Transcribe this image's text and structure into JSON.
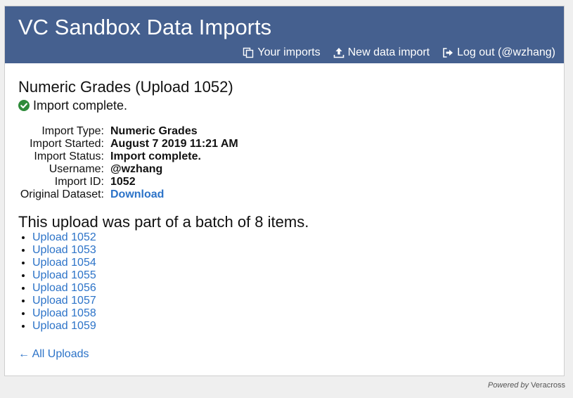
{
  "header": {
    "title": "VC Sandbox Data Imports",
    "nav": [
      {
        "label": "Your imports",
        "icon": "copy-icon"
      },
      {
        "label": "New data import",
        "icon": "upload-icon"
      },
      {
        "label": "Log out (@wzhang)",
        "icon": "logout-icon"
      }
    ]
  },
  "main": {
    "title": "Numeric Grades (Upload 1052)",
    "status": "Import complete.",
    "details": [
      {
        "label": "Import Type:",
        "value": "Numeric Grades"
      },
      {
        "label": "Import Started:",
        "value": "August 7 2019 11:21 AM"
      },
      {
        "label": "Import Status:",
        "value": "Import complete."
      },
      {
        "label": "Username:",
        "value": "@wzhang"
      },
      {
        "label": "Import ID:",
        "value": "1052"
      },
      {
        "label": "Original Dataset:",
        "value": "Download"
      }
    ],
    "batch_heading": "This upload was part of a batch of 8 items.",
    "batch_items": [
      "Upload 1052",
      "Upload 1053",
      "Upload 1054",
      "Upload 1055",
      "Upload 1056",
      "Upload 1057",
      "Upload 1058",
      "Upload 1059"
    ],
    "back_link": "← All Uploads"
  },
  "footer": {
    "powered_by": "Powered by",
    "brand": "Veracross"
  },
  "colors": {
    "header_bg": "#45608f",
    "link": "#2c73c8",
    "success": "#2e8b3a"
  }
}
